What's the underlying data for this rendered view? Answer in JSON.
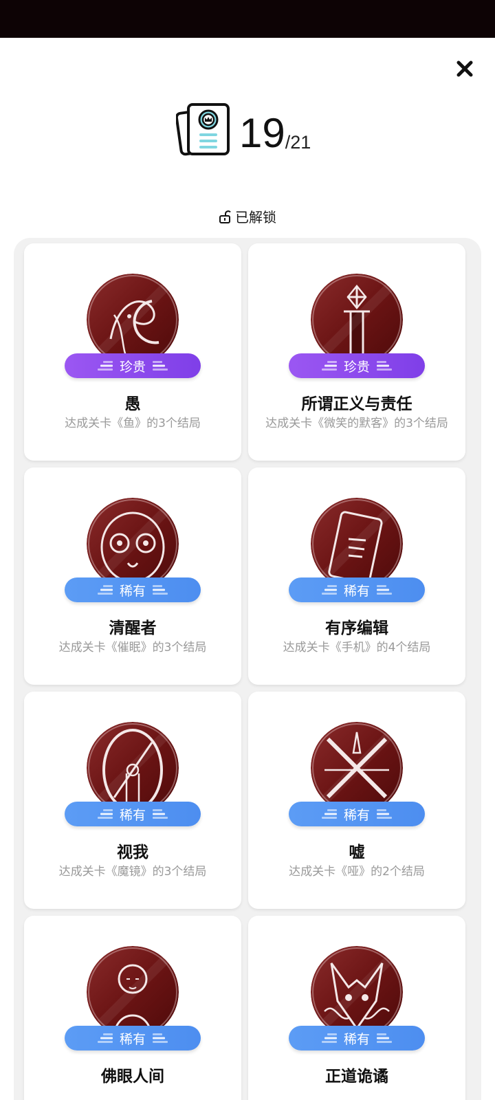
{
  "counter": {
    "unlocked": "19",
    "total": "/21"
  },
  "section": {
    "title": "已解锁"
  },
  "colors": {
    "precious": "#8b4aee",
    "rare": "#5495f2",
    "medal": "#6b1414",
    "status_bar": "#0d0305"
  },
  "icons": {
    "close": "close-icon",
    "book": "book-crown-icon",
    "lock": "unlock-icon"
  },
  "cards": [
    {
      "title": "愚",
      "desc": "达成关卡《鱼》的3个结局",
      "badge": "珍贵",
      "rarity": "precious",
      "art": "fish"
    },
    {
      "title": "所谓正义与责任",
      "desc": "达成关卡《微笑的默客》的3个结局",
      "badge": "珍贵",
      "rarity": "precious",
      "art": "sword"
    },
    {
      "title": "清醒者",
      "desc": "达成关卡《催眠》的3个结局",
      "badge": "稀有",
      "rarity": "rare",
      "art": "owl"
    },
    {
      "title": "有序编辑",
      "desc": "达成关卡《手机》的4个结局",
      "badge": "稀有",
      "rarity": "rare",
      "art": "phone"
    },
    {
      "title": "视我",
      "desc": "达成关卡《魔镜》的3个结局",
      "badge": "稀有",
      "rarity": "rare",
      "art": "mirror"
    },
    {
      "title": "嘘",
      "desc": "达成关卡《哑》的2个结局",
      "badge": "稀有",
      "rarity": "rare",
      "art": "cross"
    },
    {
      "title": "佛眼人间",
      "desc": "",
      "badge": "稀有",
      "rarity": "rare",
      "art": "buddha"
    },
    {
      "title": "正道诡谲",
      "desc": "",
      "badge": "稀有",
      "rarity": "rare",
      "art": "fox"
    }
  ]
}
